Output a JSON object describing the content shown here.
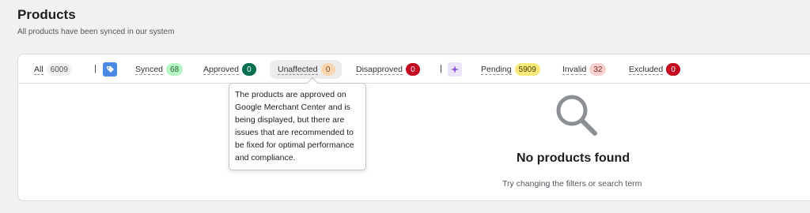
{
  "header": {
    "title": "Products",
    "subtitle": "All products have been synced in our system"
  },
  "filters": {
    "all": {
      "label": "All",
      "count": "6009",
      "badge_bg": "#f0f0f0",
      "badge_fg": "#50575e"
    },
    "synced": {
      "label": "Synced",
      "count": "68",
      "badge_bg": "#b8f5c4",
      "badge_fg": "#1e6b33"
    },
    "approved": {
      "label": "Approved",
      "count": "0",
      "badge_bg": "#006e4f",
      "badge_fg": "#ffffff"
    },
    "unaffected": {
      "label": "Unaffected",
      "count": "0",
      "badge_bg": "#fcd6b3",
      "badge_fg": "#8a4b0f"
    },
    "disapproved": {
      "label": "Disapproved",
      "count": "0",
      "badge_bg": "#c2071e",
      "badge_fg": "#ffffff"
    },
    "pending": {
      "label": "Pending",
      "count": "5909",
      "badge_bg": "#f8e97a",
      "badge_fg": "#4a4100"
    },
    "invalid": {
      "label": "Invalid",
      "count": "32",
      "badge_bg": "#fbd0d0",
      "badge_fg": "#8a1f1f"
    },
    "excluded": {
      "label": "Excluded",
      "count": "0",
      "badge_bg": "#c2071e",
      "badge_fg": "#ffffff"
    }
  },
  "separator": "|",
  "icons": {
    "google_merchant_icon": {
      "name": "google-merchant-tag-icon",
      "color": "#4a88e6"
    },
    "sparkle_icon": {
      "name": "sparkle-icon",
      "color": "#7b46d6"
    }
  },
  "tooltip": {
    "text": "The products are approved on Google Merchant Center and is being displayed, but there are issues that are recommended to be fixed for optimal performance and compliance."
  },
  "empty_state": {
    "icon": "search-icon",
    "title": "No products found",
    "hint": "Try changing the filters or search term"
  }
}
